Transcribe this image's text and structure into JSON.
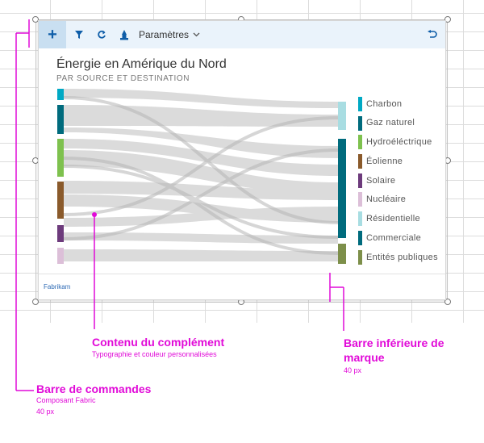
{
  "toolbar": {
    "add_icon": "plus-icon",
    "filter_icon": "filter-icon",
    "refresh_icon": "refresh-icon",
    "share_icon": "share-icon",
    "settings_label": "Paramètres",
    "settings_chevron": "chevron-down-icon",
    "undo_icon": "undo-icon"
  },
  "content": {
    "title": "Énergie en Amérique du Nord",
    "subtitle": "PAR SOURCE ET DESTINATION",
    "brand": "Fabrikam"
  },
  "legend": [
    {
      "label": "Charbon",
      "color": "#00a9c4"
    },
    {
      "label": "Gaz naturel",
      "color": "#006b7d"
    },
    {
      "label": "Hydroéléctrique",
      "color": "#7ec14e"
    },
    {
      "label": "Éolienne",
      "color": "#8a5a2b"
    },
    {
      "label": "Solaire",
      "color": "#6d3b7c"
    },
    {
      "label": "Nucléaire",
      "color": "#dcbfd8"
    },
    {
      "label": "Résidentielle",
      "color": "#a8dde2"
    },
    {
      "label": "Commerciale",
      "color": "#006b7d"
    },
    {
      "label": "Entités publiques",
      "color": "#7d8f4a"
    }
  ],
  "callouts": {
    "content": {
      "title": "Contenu du complément",
      "sub": "Typographie et couleur personnalisées"
    },
    "bottom": {
      "title_line1": "Barre inférieure de",
      "title_line2": "marque",
      "sub": "40 px"
    },
    "commands": {
      "title": "Barre de commandes",
      "sub1": "Composant Fabric",
      "sub2": "40 px"
    }
  },
  "colors": {
    "accent": "#e10ad8",
    "commandbar": "#eaf3fb",
    "brand": "#2e6bb5"
  }
}
